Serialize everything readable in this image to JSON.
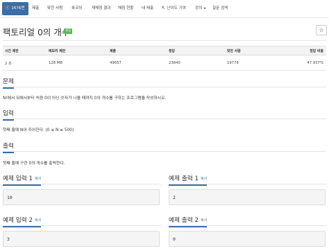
{
  "nav": {
    "tabs": [
      {
        "label": "1676번",
        "icon": "info-icon",
        "active": true
      },
      {
        "label": "제출"
      },
      {
        "label": "맞힌 사람"
      },
      {
        "label": "숏코딩"
      },
      {
        "label": "재채점 결과"
      },
      {
        "label": "채점 현황"
      },
      {
        "label": "내 제출"
      },
      {
        "label": "난이도 기여",
        "icon": "external-link-icon"
      },
      {
        "label": "강의"
      },
      {
        "label": "질문 검색"
      }
    ]
  },
  "problem": {
    "title": "팩토리얼 0의 개수",
    "badge": "성공",
    "star_icon": "star-icon"
  },
  "stats": {
    "headers": [
      "시간 제한",
      "메모리 제한",
      "제출",
      "정답",
      "맞힌 사람",
      "정답 비율"
    ],
    "values": [
      "2 초",
      "128 MB",
      "49657",
      "23840",
      "19778",
      "47.937%"
    ]
  },
  "sections": {
    "problem_heading": "문제",
    "problem_text": "N!에서 뒤에서부터 처음 0이 아닌 숫자가 나올 때까지 0의 개수를 구하는 프로그램을 작성하시오.",
    "input_heading": "입력",
    "input_text": "첫째 줄에 N이 주어진다. (0 ≤ N ≤ 500)",
    "output_heading": "출력",
    "output_text": "첫째 줄에 구한 0의 개수를 출력한다."
  },
  "examples": {
    "copy_label": "복사",
    "in1_title": "예제 입력 1",
    "in1_value": "10",
    "out1_title": "예제 출력 1",
    "out1_value": "2",
    "in2_title": "예제 입력 2",
    "in2_value": "3",
    "out2_title": "예제 출력 2",
    "out2_value": "0"
  },
  "colors": {
    "accent": "#3a6ea5",
    "success": "#5cb85c"
  }
}
